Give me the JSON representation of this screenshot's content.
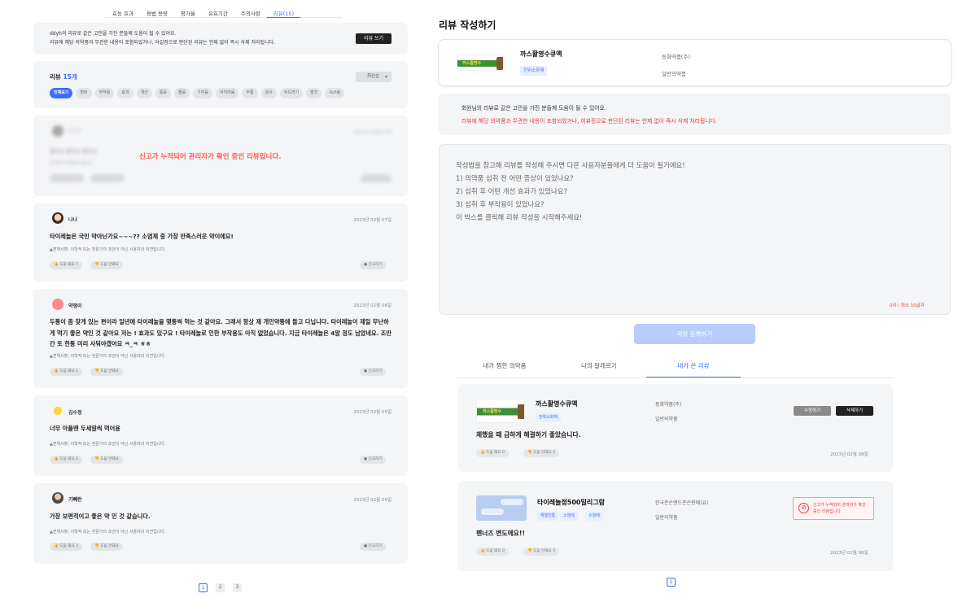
{
  "left": {
    "tabs": [
      {
        "label": "효능 효과",
        "active": false
      },
      {
        "label": "용법 용량",
        "active": false
      },
      {
        "label": "평가율",
        "active": false
      },
      {
        "label": "유효기간",
        "active": false
      },
      {
        "label": "주의사항",
        "active": false
      },
      {
        "label": "리뷰(15)",
        "active": true
      }
    ],
    "notice": {
      "line1": "ddyh의 리뷰로 같은 고민을 가진 분들께 도움이 될 수 있어요.",
      "line2": "리뷰에 해당 의약품과 무관한 내용이 포함되었거나, 어길정으로 판단된 리뷰는 언제 없이 즉시 삭제 처리됩니다.",
      "write_button": "리뷰 쓰기"
    },
    "review_header": {
      "label": "리뷰",
      "count": "15개",
      "sort": "최신순"
    },
    "filter_chips": [
      "전체보기",
      "변비",
      "부작용",
      "효과",
      "개선",
      "통증",
      "졸음",
      "가려움",
      "어지러움",
      "두통",
      "설사",
      "두드러기",
      "발진",
      "속쓰림"
    ],
    "reported_notice": "신고가 누적되어 관리자가 확인 중인 리뷰입니다.",
    "reported_blur": {
      "name": "○○○",
      "date": "2023년 02월 07일",
      "text": "좋아요 좋아요 좋아요",
      "sub": "약 먹은 후 좋아요 좋아요"
    },
    "disclaimer": "면책사항: 의학적 또는 전문가의 조언이 아닌 사용자의 의견입니다.",
    "reviews": [
      {
        "name": "나나",
        "date": "2023년 02월 07일",
        "text": "타이레놀은 국민 약아닌가요~~~?? 소염제 중 가장 만족스러운 약이에요!",
        "helpful": "도움 돼요 7",
        "not_helpful": "도움 안돼요",
        "report": "신고하기"
      },
      {
        "name": "약쟁이",
        "date": "2023년 02월 06일",
        "text": "두통이 좀 잦게 있는 편이라 일년에 타이레놀을 몇통씩 먹는 것 같아요. 그래서 항상 제 개인약통에 들고 다닙니다. 타이레놀이 제일 무난하게 먹기 좋은 약인 것 같아요 저는 ! 효과도 있구요 ! 타이레놀로 인한 부작용도 아직 없었습니다. 지금 타이레놀은 4알 정도 남았네요. 조만간 또 한통 미리 사둬야겠어요 ㅋ_ㅋ ㅎㅎ",
        "helpful": "도움 돼요 1",
        "not_helpful": "도움 안돼요",
        "report": "신고하기"
      },
      {
        "name": "김수정",
        "date": "2023년 02월 05일",
        "text": "너무 아플땐 두세알씩 먹어용",
        "helpful": "도움 돼요 2",
        "not_helpful": "도움 안돼요",
        "report": "신고하기"
      },
      {
        "name": "기빼란",
        "date": "2023년 02월 05일",
        "text": "가장 보편적이고 좋은 약 인 것 같습니다.",
        "helpful": "도움 돼요 3",
        "not_helpful": "도움 안돼요",
        "report": "신고하기"
      }
    ],
    "pages": [
      "1",
      "2",
      "3"
    ]
  },
  "right": {
    "title": "리뷰 작성하기",
    "product": {
      "name": "까스활명수큐액",
      "tag": "전위소화제",
      "company": "동화약품(주)",
      "type": "일반의약품",
      "box_label": "까스활명수"
    },
    "notice": {
      "line1": "회원님의 리뷰로 같은 고민을 가진 분들께 도움이 될 수 있어요.",
      "line2": "리뷰에 해당 의약품과 무관한 내용이 포함되었거나, 어뷰징으로 판단된 리뷰는 언제 없이 즉시 삭제 처리됩니다."
    },
    "placeholder": "작성법을 참고해 리뷰를 작성해 주시면 다른 사용자분들에게 더 도움이 될거에요!\n1) 의약품 섭취 전 어떤 증상이 있었나요?\n2) 섭취 후 어떤 개선 효과가 있었나요?\n3) 섭취 후 부작용이 있었나요?\n이 박스를 클릭해 리뷰 작성을 시작해주세요!",
    "counter": "0자 / 최소 10글자",
    "submit": "리뷰 등록하기",
    "subtabs": [
      {
        "label": "내가 찜한 의약품",
        "active": false
      },
      {
        "label": "나의 알레르기",
        "active": false
      },
      {
        "label": "내가 쓴 리뷰",
        "active": true
      }
    ],
    "my_reviews": [
      {
        "name": "까스활명수큐액",
        "tags": [
          "전위소화제"
        ],
        "company": "동화약품(주)",
        "type": "일반의약품",
        "text": "체했을 때 급하게 해결하기 좋았습니다.",
        "helpful": "도움 돼요 0",
        "not_helpful": "도움 안돼요 0",
        "date": "2023년 02월 08일",
        "edit": "수정하기",
        "delete": "삭제하기",
        "box_label": "까스활명수"
      },
      {
        "name": "타이레놀정500밀리그람",
        "tags": [
          "해열진통",
          "소염제",
          "소염제"
        ],
        "company": "한국존슨앤드존슨판매(유)",
        "type": "일반의약품",
        "text": "펜너츠 변도에요!!",
        "helpful": "도움 돼요 0",
        "not_helpful": "도움 안돼요 0",
        "date": "2023년 02월 06일",
        "warning": "신고가 누적되어 관리자가 확인 중인 리뷰입니다."
      }
    ],
    "pages": [
      "1"
    ]
  },
  "colors": {
    "accent": "#3c6cff",
    "alert": "#e43a3a",
    "card_bg": "#f4f5f7"
  }
}
